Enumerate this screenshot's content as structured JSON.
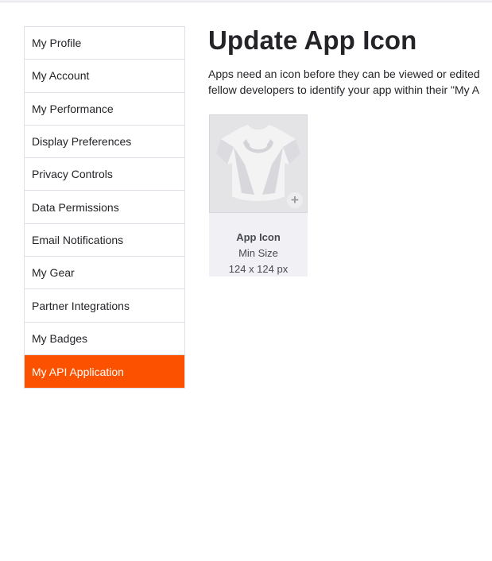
{
  "sidebar": {
    "items": [
      {
        "label": "My Profile",
        "active": false
      },
      {
        "label": "My Account",
        "active": false
      },
      {
        "label": "My Performance",
        "active": false
      },
      {
        "label": "Display Preferences",
        "active": false
      },
      {
        "label": "Privacy Controls",
        "active": false
      },
      {
        "label": "Data Permissions",
        "active": false
      },
      {
        "label": "Email Notifications",
        "active": false
      },
      {
        "label": "My Gear",
        "active": false
      },
      {
        "label": "Partner Integrations",
        "active": false
      },
      {
        "label": "My Badges",
        "active": false
      },
      {
        "label": "My API Application",
        "active": true
      }
    ]
  },
  "main": {
    "title": "Update App Icon",
    "description_line1": "Apps need an icon before they can be viewed or edited",
    "description_line2": "fellow developers to identify your app within their \"My A",
    "icon_card": {
      "placeholder_icon": "jersey-placeholder-icon",
      "add_icon": "plus-icon",
      "add_symbol": "+",
      "label": "App Icon",
      "min_size_label": "Min Size",
      "size": "124 x 124 px"
    }
  },
  "colors": {
    "accent": "#fc5200",
    "border": "#dfdfe8",
    "text": "#242428",
    "card_bg": "#f0f0f5"
  }
}
